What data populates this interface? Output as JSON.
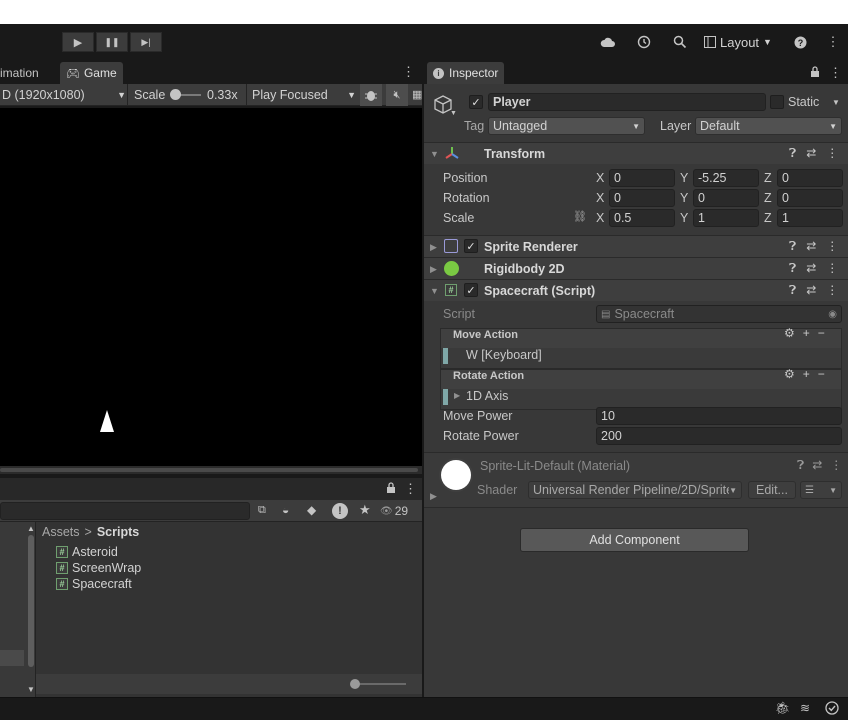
{
  "toolbar": {
    "play": "▶",
    "pause": "❚❚",
    "step": "▶|",
    "layout_label": "Layout",
    "help": "?",
    "more": "⋮",
    "icons": [
      "cloud-icon",
      "history-icon",
      "search-icon",
      "layout-icon",
      "help-icon",
      "more-icon"
    ]
  },
  "game_tabs": [
    {
      "label": "imation",
      "active": false
    },
    {
      "label": "Game",
      "active": true,
      "icon": "gamepad-icon"
    }
  ],
  "game_toolbar": {
    "resolution": "D (1920x1080)",
    "scale_label": "Scale",
    "scale_value": "0.33x",
    "play_mode": "Play Focused"
  },
  "project": {
    "breadcrumb_root": "Assets",
    "breadcrumb_sep": ">",
    "breadcrumb_current": "Scripts",
    "files": [
      "Asteroid",
      "ScreenWrap",
      "Spacecraft"
    ],
    "visible_count": "29"
  },
  "inspector": {
    "tab_label": "Inspector",
    "object_name": "Player",
    "active": true,
    "static_label": "Static",
    "tag_label": "Tag",
    "tag_value": "Untagged",
    "layer_label": "Layer",
    "layer_value": "Default",
    "transform": {
      "title": "Transform",
      "position_label": "Position",
      "rotation_label": "Rotation",
      "scale_label": "Scale",
      "position": {
        "x": "0",
        "y": "-5.25",
        "z": "0"
      },
      "rotation": {
        "x": "0",
        "y": "0",
        "z": "0"
      },
      "scale": {
        "x": "0.5",
        "y": "1",
        "z": "1"
      },
      "axis_x": "X",
      "axis_y": "Y",
      "axis_z": "Z"
    },
    "sprite_renderer": "Sprite Renderer",
    "rigidbody": "Rigidbody 2D",
    "spacecraft": {
      "title": "Spacecraft (Script)",
      "script_label": "Script",
      "script_value": "Spacecraft",
      "move_action_label": "Move Action",
      "move_binding": "W [Keyboard]",
      "rotate_action_label": "Rotate Action",
      "rotate_binding": "1D Axis",
      "move_power_label": "Move Power",
      "move_power": "10",
      "rotate_power_label": "Rotate Power",
      "rotate_power": "200"
    },
    "material": {
      "title": "Sprite-Lit-Default (Material)",
      "shader_label": "Shader",
      "shader_value": "Universal Render Pipeline/2D/Sprite",
      "edit_label": "Edit..."
    },
    "add_component": "Add Component"
  },
  "colors": {
    "background": "#383838",
    "header": "#3e3e3e",
    "accent_green": "#6f9f6f",
    "action_bar": "#7fa7a7"
  }
}
